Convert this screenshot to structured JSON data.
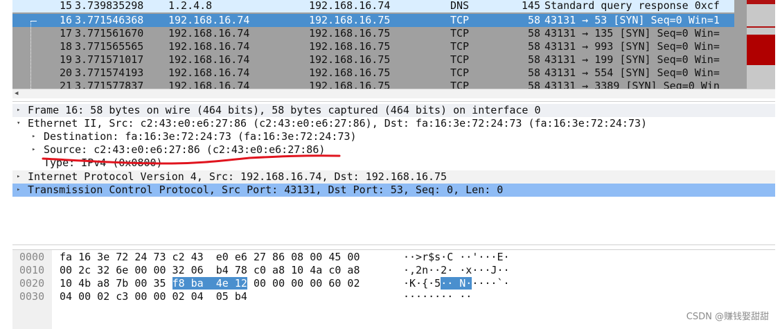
{
  "packet_list": {
    "rows": [
      {
        "no": "15",
        "time": "3.739835298",
        "source": "1.2.4.8",
        "destination": "192.168.16.74",
        "protocol": "DNS",
        "length": "145",
        "info": "Standard query response 0xcf",
        "kind": "dns"
      },
      {
        "no": "16",
        "time": "3.771546368",
        "source": "192.168.16.74",
        "destination": "192.168.16.75",
        "protocol": "TCP",
        "length": "58",
        "info": "43131 → 53 [SYN] Seq=0 Win=1",
        "kind": "selected"
      },
      {
        "no": "17",
        "time": "3.771561670",
        "source": "192.168.16.74",
        "destination": "192.168.16.75",
        "protocol": "TCP",
        "length": "58",
        "info": "43131 → 135 [SYN] Seq=0 Win=",
        "kind": "tcp"
      },
      {
        "no": "18",
        "time": "3.771565565",
        "source": "192.168.16.74",
        "destination": "192.168.16.75",
        "protocol": "TCP",
        "length": "58",
        "info": "43131 → 993 [SYN] Seq=0 Win=",
        "kind": "tcp"
      },
      {
        "no": "19",
        "time": "3.771571017",
        "source": "192.168.16.74",
        "destination": "192.168.16.75",
        "protocol": "TCP",
        "length": "58",
        "info": "43131 → 199 [SYN] Seq=0 Win=",
        "kind": "tcp"
      },
      {
        "no": "20",
        "time": "3.771574193",
        "source": "192.168.16.74",
        "destination": "192.168.16.75",
        "protocol": "TCP",
        "length": "58",
        "info": "43131 → 554 [SYN] Seq=0 Win=",
        "kind": "tcp"
      },
      {
        "no": "21",
        "time": "3.771577837",
        "source": "192.168.16.74",
        "destination": "192.168.16.75",
        "protocol": "TCP",
        "length": "58",
        "info": "43131 → 3389 [SYN] Seq=0 Win",
        "kind": "tcp"
      }
    ]
  },
  "details": {
    "frame": "Frame 16: 58 bytes on wire (464 bits), 58 bytes captured (464 bits) on interface 0",
    "ethernet": "Ethernet II, Src: c2:43:e0:e6:27:86 (c2:43:e0:e6:27:86), Dst: fa:16:3e:72:24:73 (fa:16:3e:72:24:73)",
    "eth_destination": "Destination: fa:16:3e:72:24:73 (fa:16:3e:72:24:73)",
    "eth_source": "Source: c2:43:e0:e6:27:86 (c2:43:e0:e6:27:86)",
    "eth_type": "Type: IPv4 (0x0800)",
    "ip": "Internet Protocol Version 4, Src: 192.168.16.74, Dst: 192.168.16.75",
    "tcp": "Transmission Control Protocol, Src Port: 43131, Dst Port: 53, Seq: 0, Len: 0"
  },
  "bytes": {
    "rows": [
      {
        "offset": "0000",
        "hex_pre": "fa 16 3e 72 24 73 c2 43  e0 e6 27 86 08 00 45 00",
        "hex_hl": "",
        "hex_post": "",
        "ascii_pre": "··>r$s·C ··'···E·",
        "ascii_hl": "",
        "ascii_post": ""
      },
      {
        "offset": "0010",
        "hex_pre": "00 2c 32 6e 00 00 32 06  b4 78 c0 a8 10 4a c0 a8",
        "hex_hl": "",
        "hex_post": "",
        "ascii_pre": "·,2n··2· ·x···J··",
        "ascii_hl": "",
        "ascii_post": ""
      },
      {
        "offset": "0020",
        "hex_pre": "10 4b a8 7b 00 35 ",
        "hex_hl": "f8 ba  4e 12",
        "hex_post": " 00 00 00 00 60 02",
        "ascii_pre": "·K·{·5",
        "ascii_hl": "·· N·",
        "ascii_post": "····`·"
      },
      {
        "offset": "0030",
        "hex_pre": "04 00 02 c3 00 00 02 04  05 b4",
        "hex_hl": "",
        "hex_post": "",
        "ascii_pre": "········ ··",
        "ascii_hl": "",
        "ascii_post": ""
      }
    ]
  },
  "watermark": "CSDN @赚钱娶甜甜",
  "icons": {
    "collapsed": "▸",
    "expanded": "▾",
    "scroll_down": "▼",
    "scroll_left": "◀"
  },
  "colors": {
    "selected_row": "#4a8fce",
    "dns_row": "#daeeff",
    "tcp_row": "#a0a0a0",
    "selected_detail": "#8fbcf5",
    "annotation": "#e0141e"
  }
}
